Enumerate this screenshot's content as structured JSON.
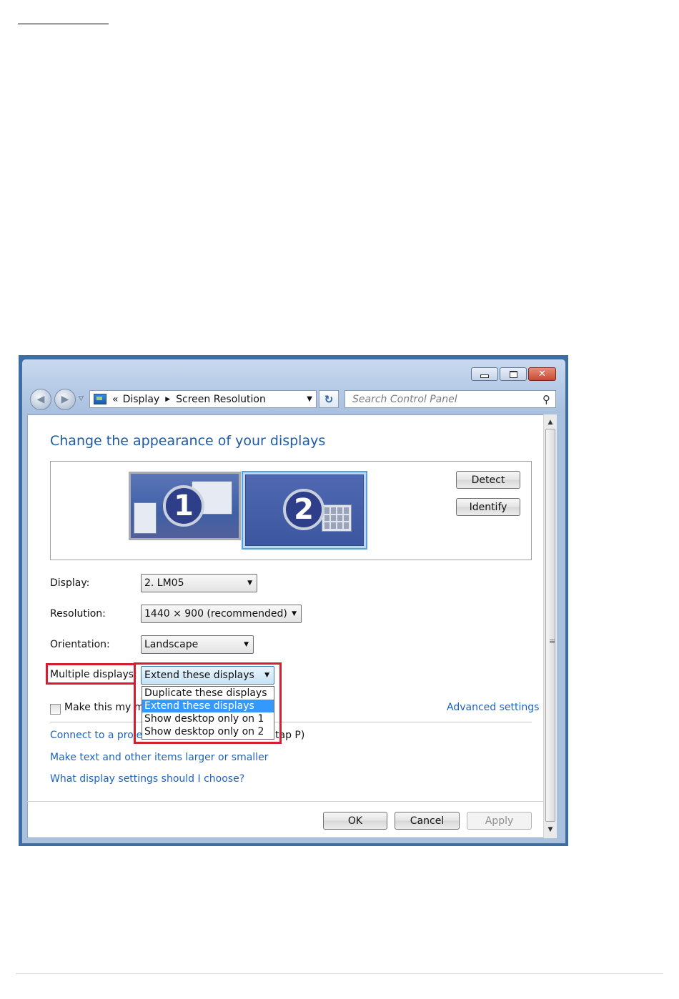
{
  "window": {
    "buttons": {
      "minimize_icon": "minimize-icon",
      "maximize_icon": "maximize-icon",
      "close_label": "✕"
    }
  },
  "nav": {
    "back_glyph": "◀",
    "forward_glyph": "▶",
    "history_glyph": "▽",
    "breadcrumb_prefix": "«",
    "breadcrumb": [
      "Display",
      "Screen Resolution"
    ],
    "breadcrumb_arrow": "▶",
    "address_dropdown": "▼",
    "refresh_glyph": "↻",
    "search_placeholder": "Search Control Panel",
    "search_glyph": "⚲"
  },
  "page": {
    "title": "Change the appearance of your displays",
    "monitors": [
      "1",
      "2"
    ],
    "detect_label": "Detect",
    "identify_label": "Identify"
  },
  "settings": {
    "display_label": "Display:",
    "display_value": "2. LM05",
    "resolution_label": "Resolution:",
    "resolution_value": "1440 × 900 (recommended)",
    "orientation_label": "Orientation:",
    "orientation_value": "Landscape",
    "multiple_label": "Multiple displays:",
    "multiple_value": "Extend these displays",
    "arrow": "▼",
    "options": [
      "Duplicate these displays",
      "Extend these displays",
      "Show desktop only on 1",
      "Show desktop only on 2"
    ],
    "selected_index": 1
  },
  "main_display": {
    "checkbox_text_visible": "Make this my ma",
    "checked": false,
    "advanced_link": "Advanced settings"
  },
  "links": {
    "projector_left": "Connect to a proje",
    "projector_right": "tap P)",
    "text_size": "Make text and other items larger or smaller",
    "help": "What display settings should I choose?"
  },
  "footer": {
    "ok": "OK",
    "cancel": "Cancel",
    "apply": "Apply",
    "apply_enabled": false
  },
  "scrollbar": {
    "up": "▲",
    "down": "▼",
    "grip": "≡"
  },
  "colors": {
    "highlight_box": "#d2202f",
    "selected_option": "#3399ff",
    "link": "#1c63c0",
    "heading": "#1d5ba6"
  }
}
